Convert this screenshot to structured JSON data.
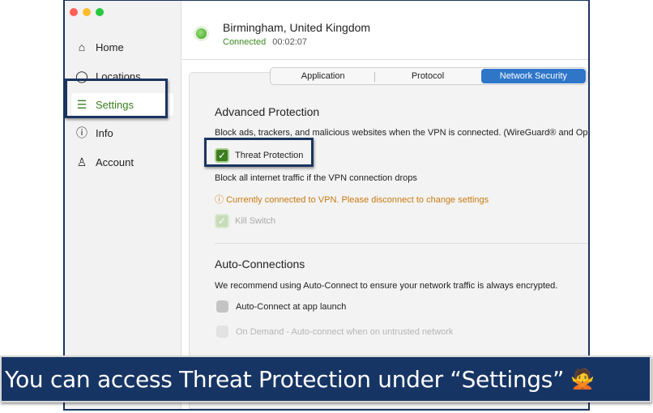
{
  "sidebar": {
    "items": [
      {
        "label": "Home",
        "icon": "home-icon",
        "glyph": "⌂"
      },
      {
        "label": "Locations",
        "icon": "location-pin-icon",
        "glyph": "◯"
      },
      {
        "label": "Settings",
        "icon": "sliders-icon",
        "glyph": "☰",
        "active": true
      },
      {
        "label": "Info",
        "icon": "info-icon",
        "glyph": "ⓘ"
      },
      {
        "label": "Account",
        "icon": "user-icon",
        "glyph": "♙"
      }
    ]
  },
  "header": {
    "location": "Birmingham, United Kingdom",
    "status": "Connected",
    "timer": "00:02:07",
    "status_color": "#3a8a20"
  },
  "tabs": [
    {
      "label": "Application"
    },
    {
      "label": "Protocol"
    },
    {
      "label": "Network Security",
      "selected": true
    }
  ],
  "advanced": {
    "title": "Advanced Protection",
    "description": "Block ads, trackers, and malicious websites when the VPN is connected. (WireGuard® and Ope",
    "threat_label": "Threat Protection",
    "threat_checked": true,
    "killswitch_description": "Block all internet traffic if the VPN connection drops",
    "warning": "Currently connected to VPN. Please disconnect to change settings",
    "killswitch_label": "Kill Switch",
    "killswitch_checked": true
  },
  "auto": {
    "title": "Auto-Connections",
    "description": "We recommend using Auto-Connect to ensure your network traffic is always encrypted.",
    "launch_label": "Auto-Connect at app launch",
    "ondemand_label": "On Demand - Auto-connect when on untrusted network"
  },
  "banner": {
    "text": "You can access Threat Protection under “Settings”",
    "emoji": "🙅"
  },
  "colors": {
    "accent": "#2f76c9",
    "highlight": "#1b3560",
    "warning": "#c87a10"
  }
}
